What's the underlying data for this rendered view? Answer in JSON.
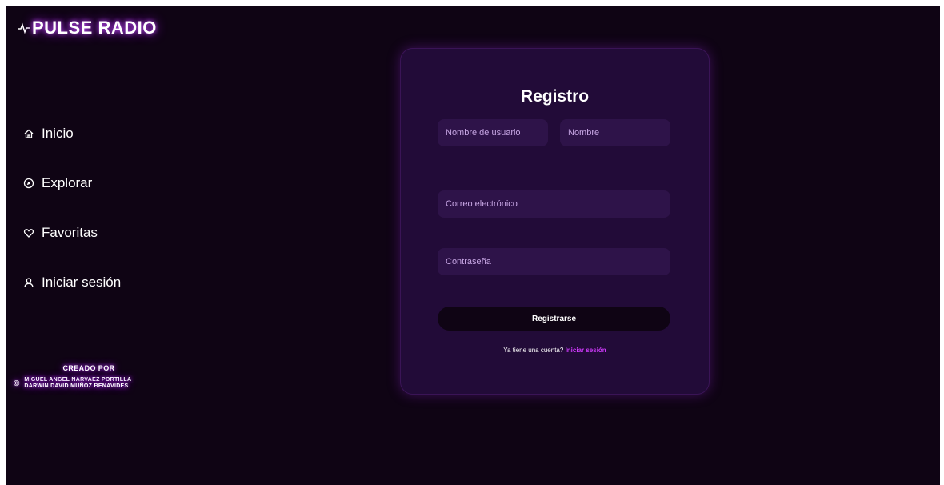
{
  "brand": {
    "name": "PULSE RADIO",
    "icon": "pulse-icon"
  },
  "nav": {
    "items": [
      {
        "label": "Inicio",
        "icon": "home-icon"
      },
      {
        "label": "Explorar",
        "icon": "compass-icon"
      },
      {
        "label": "Favoritas",
        "icon": "heart-icon"
      },
      {
        "label": "Iniciar sesión",
        "icon": "user-icon"
      }
    ]
  },
  "credits": {
    "title": "CREADO POR",
    "symbol": "©",
    "authors": [
      "MIGUEL ANGEL NARVAEZ PORTILLA",
      "DARWIN DAVID MUÑOZ BENAVIDES"
    ]
  },
  "form": {
    "title": "Registro",
    "username_placeholder": "Nombre de usuario",
    "name_placeholder": "Nombre",
    "email_placeholder": "Correo electrónico",
    "password_placeholder": "Contraseña",
    "submit_label": "Registrarse",
    "login_prompt": "Ya tiene una cuenta?",
    "login_link": "Iniciar sesión"
  },
  "colors": {
    "background": "#0f0414",
    "card": "#220b38",
    "field": "#2e1349",
    "accent": "#d23bff"
  }
}
